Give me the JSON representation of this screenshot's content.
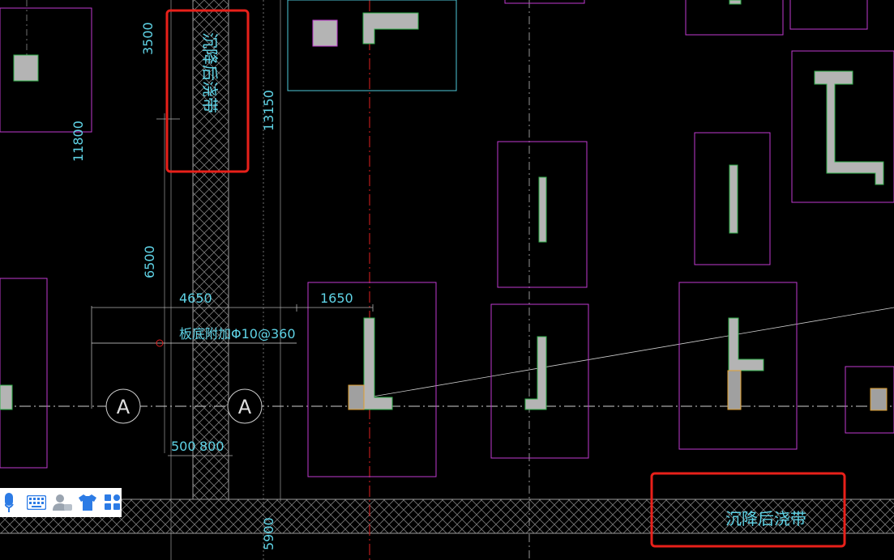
{
  "canvas": {
    "background": "#000000",
    "colors": {
      "column_outline": "#c03ad0",
      "dimension_text": "#5fd3e6",
      "axis_line": "#d0d0d0",
      "red_axis": "#e02020",
      "wall_fill": "#b4b4b4",
      "wall_edge": "#2fb04a",
      "highlight_box": "#e8201a",
      "hatch": "#7a7a7a"
    }
  },
  "annotations": {
    "post_pour_band_vertical": "沉降后浇带",
    "post_pour_band_horizontal": "沉降后浇带",
    "rebar_note": "板底附加Φ10@360"
  },
  "dimensions": {
    "d3500": "3500",
    "d13150": "13150",
    "d11800": "11800",
    "d6500": "6500",
    "d4650": "4650",
    "d1650": "1650",
    "d500": "500",
    "d800": "800",
    "d5900": "5900"
  },
  "axis_labels": {
    "axis_a_left": "A",
    "axis_a_right": "A"
  },
  "toolbar": {
    "items": [
      {
        "name": "microphone-icon",
        "color": "#2c7be5"
      },
      {
        "name": "keyboard-icon",
        "color": "#2c7be5"
      },
      {
        "name": "user-group-icon",
        "color": "#9aa4b0"
      },
      {
        "name": "shirt-icon",
        "color": "#2c7be5"
      },
      {
        "name": "grid-apps-icon",
        "color": "#2c7be5"
      }
    ]
  }
}
